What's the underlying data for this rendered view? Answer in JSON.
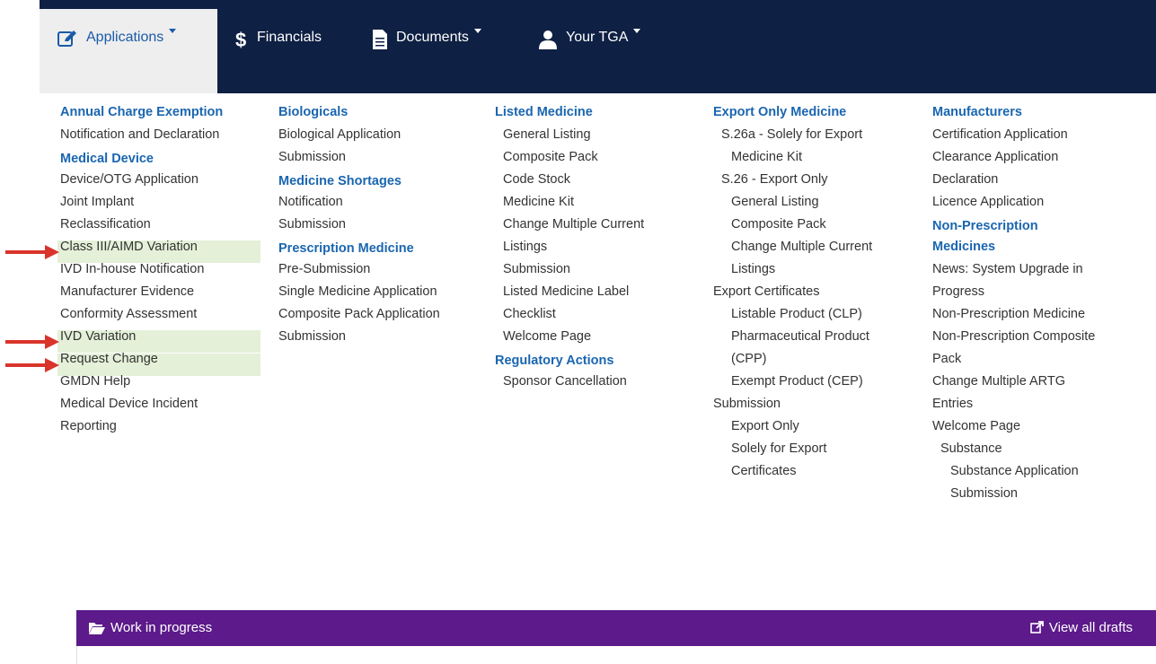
{
  "nav": {
    "applications": "Applications",
    "financials": "Financials",
    "documents": "Documents",
    "your_tga": "Your TGA"
  },
  "col1": {
    "annual_charge_exemption": "Annual Charge Exemption",
    "notification_and_declaration": "Notification and Declaration",
    "medical_device": "Medical Device",
    "items": [
      "Device/OTG Application",
      "Joint Implant",
      "Reclassification",
      "Class III/AIMD Variation",
      "IVD In-house Notification",
      "Manufacturer Evidence",
      "Conformity Assessment",
      "IVD Variation",
      "Request Change",
      "GMDN Help",
      "Medical Device Incident",
      "Reporting"
    ]
  },
  "col2": {
    "biologicals": "Biologicals",
    "biologicals_items": [
      "Biological Application",
      "Submission"
    ],
    "medicine_shortages": "Medicine Shortages",
    "shortages_items": [
      "Notification",
      "Submission"
    ],
    "prescription_medicine": "Prescription Medicine",
    "prescription_items": [
      "Pre-Submission",
      "Single Medicine Application",
      "Composite Pack Application",
      "Submission"
    ]
  },
  "col3": {
    "listed_medicine": "Listed Medicine",
    "listed_items": [
      "General Listing",
      "Composite Pack",
      "Code Stock",
      "Medicine Kit",
      "Change Multiple Current",
      "Listings",
      "Submission",
      "Listed Medicine Label",
      "Checklist",
      "Welcome Page"
    ],
    "regulatory_actions": "Regulatory Actions",
    "regulatory_items": [
      "Sponsor Cancellation"
    ]
  },
  "col4": {
    "export_only_medicine": "Export Only Medicine",
    "items": [
      {
        "text": "S.26a - Solely for Export",
        "indent": 1
      },
      {
        "text": "Medicine Kit",
        "indent": 2
      },
      {
        "text": "S.26 - Export Only",
        "indent": 1
      },
      {
        "text": "General Listing",
        "indent": 2
      },
      {
        "text": "Composite Pack",
        "indent": 2
      },
      {
        "text": "Change Multiple Current",
        "indent": 2
      },
      {
        "text": "Listings",
        "indent": 2
      },
      {
        "text": "Export Certificates",
        "indent": 0
      },
      {
        "text": "Listable Product (CLP)",
        "indent": 2
      },
      {
        "text": "Pharmaceutical Product",
        "indent": 2
      },
      {
        "text": "(CPP)",
        "indent": 2
      },
      {
        "text": "Exempt Product (CEP)",
        "indent": 2
      },
      {
        "text": "Submission",
        "indent": 0
      },
      {
        "text": "Export Only",
        "indent": 2
      },
      {
        "text": "Solely for Export",
        "indent": 2
      },
      {
        "text": "Certificates",
        "indent": 2
      }
    ]
  },
  "col5": {
    "manufacturers": "Manufacturers",
    "manufacturers_items": [
      "Certification Application",
      "Clearance Application",
      "Declaration",
      "Licence Application"
    ],
    "non_prescription_1": "Non-Prescription",
    "non_prescription_2": "Medicines",
    "np_items": [
      {
        "text": "News: System Upgrade in",
        "indent": 0
      },
      {
        "text": "Progress",
        "indent": 0
      },
      {
        "text": "Non-Prescription Medicine",
        "indent": 0
      },
      {
        "text": "Non-Prescription Composite",
        "indent": 0
      },
      {
        "text": "Pack",
        "indent": 0
      },
      {
        "text": "Change Multiple ARTG",
        "indent": 0
      },
      {
        "text": "Entries",
        "indent": 0
      },
      {
        "text": "Welcome Page",
        "indent": 0
      },
      {
        "text": "Substance",
        "indent": 1
      },
      {
        "text": "Substance Application",
        "indent": 2
      },
      {
        "text": "Submission",
        "indent": 2
      }
    ]
  },
  "wip": {
    "title": "Work in progress",
    "view_all": "View all drafts"
  },
  "colors": {
    "navbar": "#0e2043",
    "heading": "#1a66b0",
    "highlight": "#e4f0d8",
    "arrow": "#d9342b",
    "wip_bar": "#5c1a8a"
  }
}
